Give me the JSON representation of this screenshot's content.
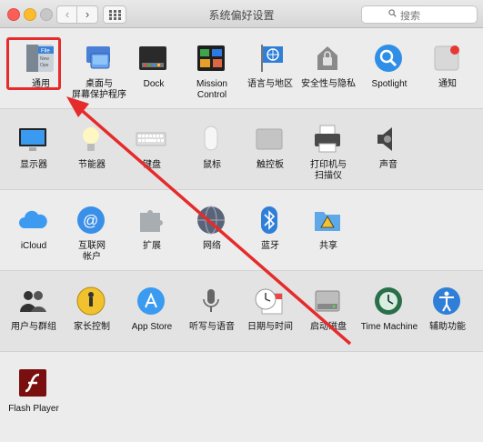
{
  "window": {
    "title": "系统偏好设置",
    "search_placeholder": "搜索"
  },
  "rows": [
    [
      {
        "id": "general",
        "label": "通用",
        "icon": "general-icon"
      },
      {
        "id": "desktop",
        "label": "桌面与\n屏幕保护程序",
        "icon": "desktop-screensaver-icon"
      },
      {
        "id": "dock",
        "label": "Dock",
        "icon": "dock-icon"
      },
      {
        "id": "mission",
        "label": "Mission\nControl",
        "icon": "mission-control-icon"
      },
      {
        "id": "language",
        "label": "语言与地区",
        "icon": "language-region-icon"
      },
      {
        "id": "security",
        "label": "安全性与隐私",
        "icon": "security-privacy-icon"
      },
      {
        "id": "spotlight",
        "label": "Spotlight",
        "icon": "spotlight-icon"
      },
      {
        "id": "notifications",
        "label": "通知",
        "icon": "notifications-icon"
      }
    ],
    [
      {
        "id": "displays",
        "label": "显示器",
        "icon": "displays-icon"
      },
      {
        "id": "energy",
        "label": "节能器",
        "icon": "energy-saver-icon"
      },
      {
        "id": "keyboard",
        "label": "键盘",
        "icon": "keyboard-icon"
      },
      {
        "id": "mouse",
        "label": "鼠标",
        "icon": "mouse-icon"
      },
      {
        "id": "trackpad",
        "label": "触控板",
        "icon": "trackpad-icon"
      },
      {
        "id": "printers",
        "label": "打印机与\n扫描仪",
        "icon": "printer-icon"
      },
      {
        "id": "sound",
        "label": "声音",
        "icon": "sound-icon"
      }
    ],
    [
      {
        "id": "icloud",
        "label": "iCloud",
        "icon": "icloud-icon"
      },
      {
        "id": "internet",
        "label": "互联网\n帐户",
        "icon": "internet-accounts-icon"
      },
      {
        "id": "extensions",
        "label": "扩展",
        "icon": "extensions-icon"
      },
      {
        "id": "network",
        "label": "网络",
        "icon": "network-icon"
      },
      {
        "id": "bluetooth",
        "label": "蓝牙",
        "icon": "bluetooth-icon"
      },
      {
        "id": "sharing",
        "label": "共享",
        "icon": "sharing-icon"
      }
    ],
    [
      {
        "id": "users",
        "label": "用户与群组",
        "icon": "users-groups-icon"
      },
      {
        "id": "parental",
        "label": "家长控制",
        "icon": "parental-controls-icon"
      },
      {
        "id": "appstore",
        "label": "App Store",
        "icon": "app-store-icon"
      },
      {
        "id": "dictation",
        "label": "听写与语音",
        "icon": "dictation-speech-icon"
      },
      {
        "id": "datetime",
        "label": "日期与时间",
        "icon": "date-time-icon"
      },
      {
        "id": "startup",
        "label": "启动磁盘",
        "icon": "startup-disk-icon"
      },
      {
        "id": "timemachine",
        "label": "Time Machine",
        "icon": "time-machine-icon"
      },
      {
        "id": "accessibility",
        "label": "辅助功能",
        "icon": "accessibility-icon"
      }
    ],
    [
      {
        "id": "flash",
        "label": "Flash Player",
        "icon": "flash-player-icon"
      }
    ]
  ],
  "general_icon_text": [
    "File",
    "New",
    "Ope"
  ],
  "annotation": {
    "color": "#e52b2b"
  }
}
